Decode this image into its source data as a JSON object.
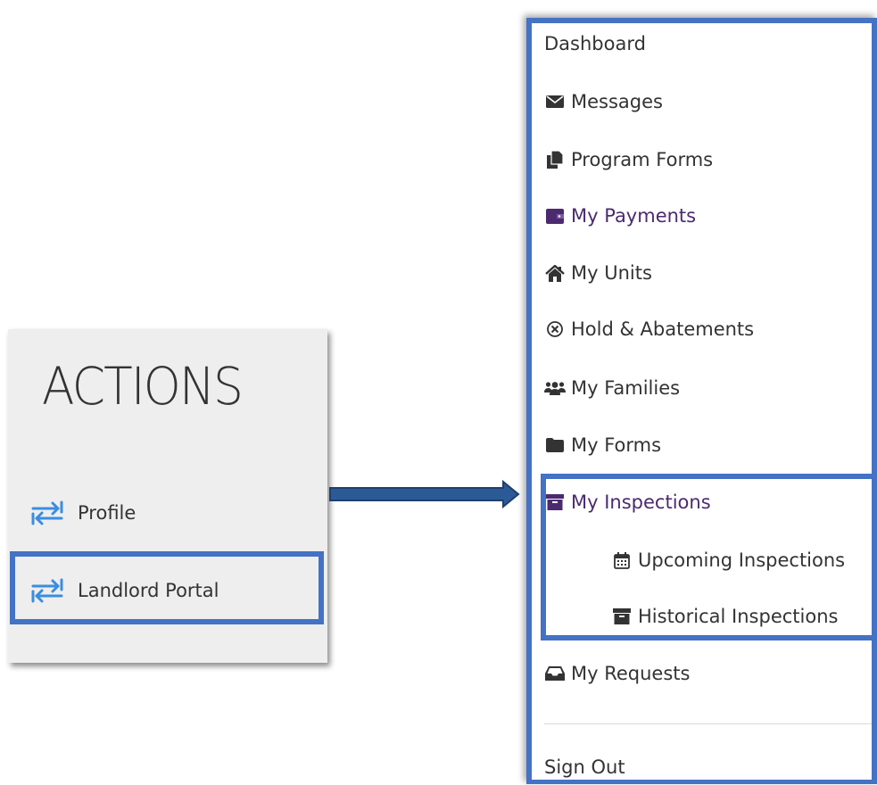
{
  "actions": {
    "title": "ACTIONS",
    "items": [
      {
        "label": "Profile",
        "icon": "exchange-icon"
      },
      {
        "label": "Landlord Portal",
        "icon": "exchange-icon"
      }
    ]
  },
  "menu": {
    "items": [
      {
        "label": "Dashboard",
        "icon": ""
      },
      {
        "label": "Messages",
        "icon": "envelope-icon"
      },
      {
        "label": "Program Forms",
        "icon": "copy-icon"
      },
      {
        "label": "My Payments",
        "icon": "wallet-icon"
      },
      {
        "label": "My Units",
        "icon": "home-icon"
      },
      {
        "label": "Hold & Abatements",
        "icon": "times-circle-icon"
      },
      {
        "label": "My Families",
        "icon": "users-icon"
      },
      {
        "label": "My Forms",
        "icon": "folder-icon"
      },
      {
        "label": "My Inspections",
        "icon": "archive-icon"
      },
      {
        "label": "Upcoming Inspections",
        "icon": "calendar-icon"
      },
      {
        "label": "Historical Inspections",
        "icon": "archive-icon"
      },
      {
        "label": "My Requests",
        "icon": "inbox-icon"
      },
      {
        "label": "Sign Out",
        "icon": ""
      }
    ]
  },
  "colors": {
    "highlight": "#4472c4",
    "accent_purple": "#4b2a6f",
    "icon_blue": "#3b8de0",
    "text": "#333333",
    "panel_bg": "#eeeeee"
  }
}
